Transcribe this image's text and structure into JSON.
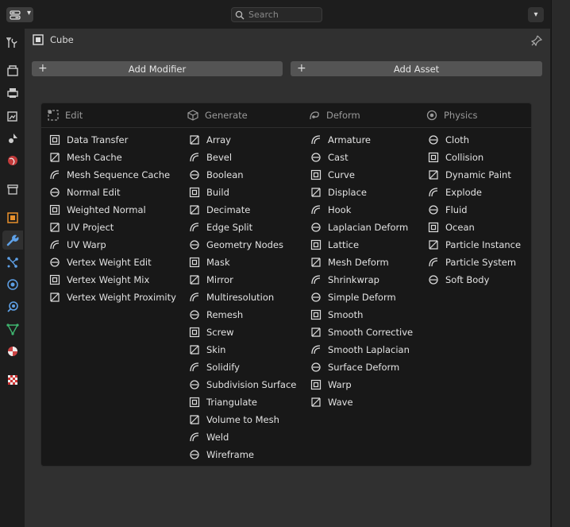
{
  "topbar": {
    "search_placeholder": "Search"
  },
  "sidebar": {
    "items": [
      {
        "name": "tool-icon"
      },
      {
        "name": "render-icon"
      },
      {
        "name": "output-icon"
      },
      {
        "name": "view-layer-icon"
      },
      {
        "name": "scene-icon"
      },
      {
        "name": "world-icon"
      },
      {
        "name": "collection-icon"
      },
      {
        "name": "object-icon"
      },
      {
        "name": "modifiers-icon",
        "active": true
      },
      {
        "name": "particles-icon"
      },
      {
        "name": "physics-icon"
      },
      {
        "name": "constraints-icon"
      },
      {
        "name": "data-icon"
      },
      {
        "name": "material-icon"
      },
      {
        "name": "texture-icon"
      }
    ]
  },
  "header": {
    "object_name": "Cube"
  },
  "buttons": {
    "add_modifier": "Add Modifier",
    "add_asset": "Add Asset"
  },
  "menu": {
    "columns": [
      {
        "heading": "Edit",
        "icon": "edit-icon",
        "items": [
          "Data Transfer",
          "Mesh Cache",
          "Mesh Sequence Cache",
          "Normal Edit",
          "Weighted Normal",
          "UV Project",
          "UV Warp",
          "Vertex Weight Edit",
          "Vertex Weight Mix",
          "Vertex Weight Proximity"
        ]
      },
      {
        "heading": "Generate",
        "icon": "generate-icon",
        "items": [
          "Array",
          "Bevel",
          "Boolean",
          "Build",
          "Decimate",
          "Edge Split",
          "Geometry Nodes",
          "Mask",
          "Mirror",
          "Multiresolution",
          "Remesh",
          "Screw",
          "Skin",
          "Solidify",
          "Subdivision Surface",
          "Triangulate",
          "Volume to Mesh",
          "Weld",
          "Wireframe"
        ]
      },
      {
        "heading": "Deform",
        "icon": "deform-icon",
        "items": [
          "Armature",
          "Cast",
          "Curve",
          "Displace",
          "Hook",
          "Laplacian Deform",
          "Lattice",
          "Mesh Deform",
          "Shrinkwrap",
          "Simple Deform",
          "Smooth",
          "Smooth Corrective",
          "Smooth Laplacian",
          "Surface Deform",
          "Warp",
          "Wave"
        ]
      },
      {
        "heading": "Physics",
        "icon": "physics-icon",
        "items": [
          "Cloth",
          "Collision",
          "Dynamic Paint",
          "Explode",
          "Fluid",
          "Ocean",
          "Particle Instance",
          "Particle System",
          "Soft Body"
        ]
      }
    ]
  },
  "colors": {
    "panel_bg": "#303030",
    "menu_bg": "#181818",
    "button_bg": "#545454",
    "modifier_active": "#5ea0e6",
    "object_orange": "#e8902c"
  }
}
